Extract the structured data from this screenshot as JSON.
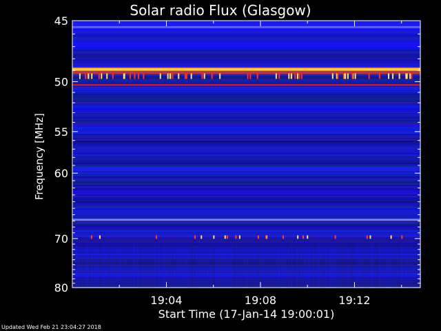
{
  "chart_data": {
    "type": "heatmap",
    "title": "Solar radio Flux (Glasgow)",
    "xlabel": "Start Time (17-Jan-14 19:00:01)",
    "ylabel": "Frequency [MHz]",
    "x_start_minutes": 0,
    "x_end_minutes": 14.8,
    "x_ticks": [
      {
        "minute": 4,
        "label": "19:04"
      },
      {
        "minute": 8,
        "label": "19:08"
      },
      {
        "minute": 12,
        "label": "19:12"
      }
    ],
    "y_range": [
      45,
      80
    ],
    "y_scale": "reciprocal",
    "y_ticks": [
      45,
      50,
      55,
      60,
      70,
      80
    ],
    "y_tick_labels": [
      "45",
      "50",
      "55",
      "60",
      "70",
      "80"
    ],
    "strong_emission_bands_mhz": [
      48.9,
      50.3,
      66.8
    ],
    "intermittent_emission_mhz": [
      49.5,
      69.8
    ],
    "colormap": [
      "#000060",
      "#1010d0",
      "#3030ff",
      "#ff2020",
      "#ffd040"
    ]
  },
  "footer": {
    "updated": "Updated Wed Feb 21 23:04:27 2018"
  }
}
